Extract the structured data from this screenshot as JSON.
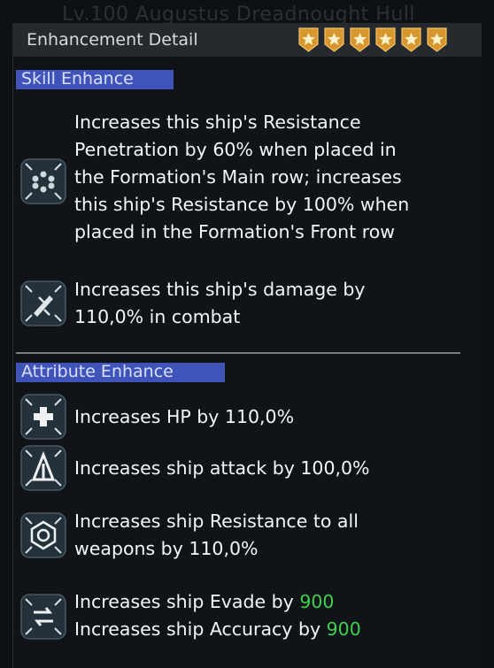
{
  "background": {
    "ghost_title": "Lv.100   Augustus Dreadnought Hull"
  },
  "header": {
    "title": "Enhancement Detail",
    "stars": 6,
    "star_color": "#e0a23a"
  },
  "skill_section": {
    "label": "Skill Enhance",
    "items": [
      {
        "icon": "module-grid-icon",
        "lines": [
          "Increases this ship's Resistance",
          "Penetration by 60% when placed in",
          "the Formation's Main row; increases",
          "this ship's Resistance by 100% when",
          "placed in the Formation's Front row"
        ]
      },
      {
        "icon": "missile-icon",
        "lines": [
          "Increases this ship's damage by",
          "110,0% in combat"
        ]
      }
    ]
  },
  "attribute_section": {
    "label": "Attribute Enhance",
    "items": [
      {
        "icon": "hp-cross-icon",
        "lines": [
          "Increases HP by 110,0%"
        ]
      },
      {
        "icon": "attack-arrow-icon",
        "lines": [
          "Increases ship attack by 100,0%"
        ]
      },
      {
        "icon": "resistance-shield-icon",
        "lines": [
          "Increases ship Resistance to all",
          "weapons by 110,0%"
        ]
      },
      {
        "icon": "evade-accuracy-icon",
        "evade_text": "Increases ship Evade by",
        "evade_value": "900",
        "accuracy_text": "Increases ship Accuracy by",
        "accuracy_value": "900"
      }
    ]
  },
  "colors": {
    "section_bar": "#3f53b8",
    "value_green": "#3fd04f",
    "panel_bg": "#111418"
  }
}
